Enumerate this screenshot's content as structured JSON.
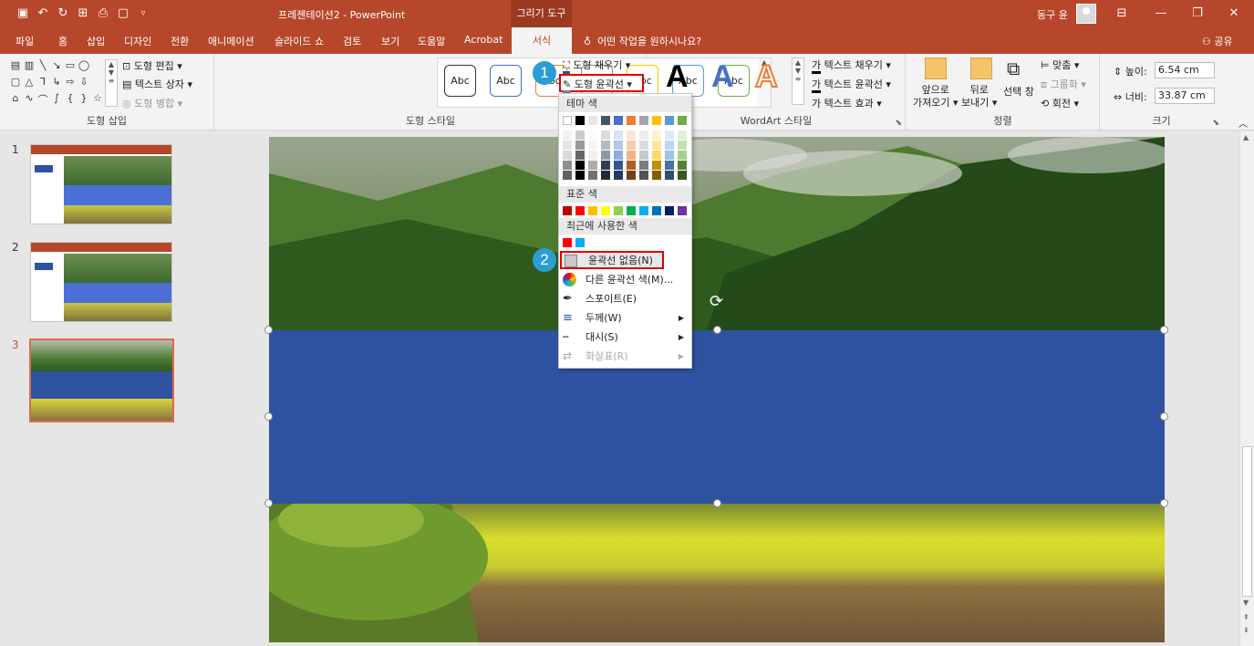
{
  "titlebar": {
    "doc_title": "프레젠테이션2  -  PowerPoint",
    "tool_context": "그리기 도구",
    "user_name": "동구 윤"
  },
  "tabs": [
    "파일",
    "홈",
    "삽입",
    "디자인",
    "전환",
    "애니메이션",
    "슬라이드 쇼",
    "검토",
    "보기",
    "도움말",
    "Acrobat"
  ],
  "active_tab": "서식",
  "tell_me": "어떤 작업을 원하시나요?",
  "share": "공유",
  "ribbon": {
    "insert_shapes": {
      "label": "도형 삽입",
      "edit_shape": "도형 편집",
      "text_box": "텍스트 상자",
      "merge_shapes": "도형 병합"
    },
    "shape_styles": {
      "label": "도형 스타일",
      "style_sample": "Abc",
      "fill": "도형 채우기",
      "outline": "도형 윤곽선"
    },
    "wordart": {
      "label": "WordArt 스타일",
      "letter": "A",
      "text_fill": "텍스트 채우기",
      "text_outline": "텍스트 윤곽선",
      "text_effect": "텍스트 효과"
    },
    "arrange": {
      "label": "정렬",
      "bring_forward_1": "앞으로",
      "bring_forward_2": "가져오기",
      "send_backward_1": "뒤로",
      "send_backward_2": "보내기",
      "selection_pane": "선택 창",
      "align": "맞춤",
      "group": "그룹화",
      "rotate": "회전"
    },
    "size": {
      "label": "크기",
      "height_label": "높이:",
      "height_value": "6.54 cm",
      "width_label": "너비:",
      "width_value": "33.87 cm"
    }
  },
  "thumbnails": [
    "1",
    "2",
    "3"
  ],
  "dropdown": {
    "theme_colors": "테마 색",
    "standard_colors": "표준 색",
    "recent_colors": "최근에 사용한 색",
    "no_outline": "윤곽선 없음(N)",
    "more_colors": "다른 윤곽선 색(M)...",
    "eyedropper": "스포이트(E)",
    "weight": "두께(W)",
    "dashes": "대시(S)",
    "arrows": "화살표(R)"
  },
  "steps": [
    "1",
    "2"
  ],
  "colors": {
    "accent": "#b7472a",
    "shape_fill": "#2f52a0",
    "highlight": "#e00000",
    "step_badge": "#2a9dd3",
    "theme_top": [
      "#ffffff",
      "#000000",
      "#e7e6e6",
      "#44546a",
      "#4472c4",
      "#ed7d31",
      "#a5a5a5",
      "#ffc000",
      "#5b9bd5",
      "#70ad47"
    ],
    "standard": [
      "#c00000",
      "#ff0000",
      "#ffc000",
      "#ffff00",
      "#92d050",
      "#00b050",
      "#00b0f0",
      "#0070c0",
      "#002060",
      "#7030a0"
    ],
    "recent": [
      "#ff0000",
      "#00b0f0"
    ]
  }
}
